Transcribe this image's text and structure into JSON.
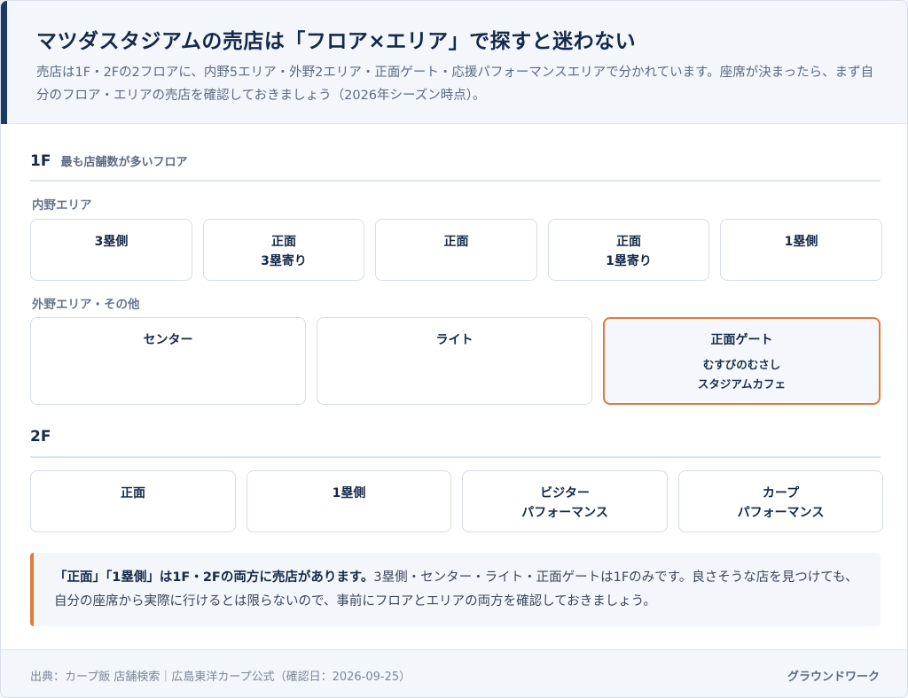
{
  "header": {
    "title": "マツダスタジアムの売店は「フロア×エリア」で探すと迷わない",
    "subtitle": "売店は1F・2Fの2フロアに、内野5エリア・外野2エリア・正面ゲート・応援パフォーマンスエリアで分かれています。座席が決まったら、まず自分のフロア・エリアの売店を確認しておきましょう（2026年シーズン時点）。"
  },
  "floor1": {
    "label": "1F",
    "desc": "最も店舗数が多いフロア",
    "infield_label": "内野エリア",
    "infield": [
      {
        "line1": "3塁側",
        "line2": ""
      },
      {
        "line1": "正面",
        "line2": "3塁寄り"
      },
      {
        "line1": "正面",
        "line2": ""
      },
      {
        "line1": "正面",
        "line2": "1塁寄り"
      },
      {
        "line1": "1塁側",
        "line2": ""
      }
    ],
    "outfield_label": "外野エリア・その他",
    "outfield": [
      {
        "line1": "センター"
      },
      {
        "line1": "ライト"
      }
    ],
    "gate": {
      "title": "正面ゲート",
      "sub1": "むすびのむさし",
      "sub2": "スタジアムカフェ"
    }
  },
  "floor2": {
    "label": "2F",
    "tiles": [
      {
        "line1": "正面",
        "line2": ""
      },
      {
        "line1": "1塁側",
        "line2": ""
      },
      {
        "line1": "ビジター",
        "line2": "パフォーマンス"
      },
      {
        "line1": "カープ",
        "line2": "パフォーマンス"
      }
    ]
  },
  "note": {
    "strong": "「正面」「1塁側」は1F・2Fの両方に売店があります。",
    "text": "3塁側・センター・ライト・正面ゲートは1Fのみです。良さそうな店を見つけても、自分の座席から実際に行けるとは限らないので、事前にフロアとエリアの両方を確認しておきましょう。"
  },
  "footer": {
    "source": "出典：カープ飯 店舗検索｜広島東洋カープ公式（確認日：2026-09-25）",
    "brand": "グラウンドワーク"
  },
  "colors": {
    "navy": "#1c3a66",
    "accent": "#e07b39",
    "panel": "#f3f6fa"
  }
}
